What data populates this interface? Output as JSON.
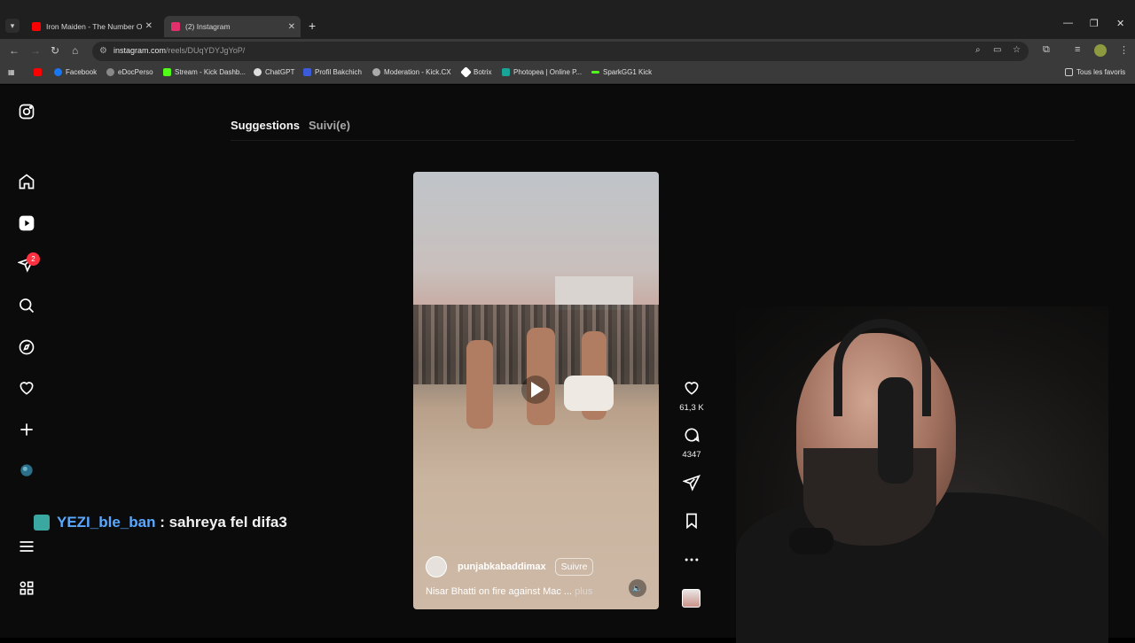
{
  "browser": {
    "tabs": [
      {
        "title": "Iron Maiden - The Number Of T",
        "favicon_color": "#ff0000",
        "active": false
      },
      {
        "title": "(2) Instagram",
        "favicon_color": "#e1306c",
        "active": true
      }
    ],
    "url_host": "instagram.com",
    "url_path": "/reels/DUqYDYJgYoP/",
    "bookmarks": [
      {
        "label": "",
        "color": "#ff0000"
      },
      {
        "label": "Facebook",
        "color": "#1877f2"
      },
      {
        "label": "eDocPerso",
        "color": "#cccccc"
      },
      {
        "label": "Stream - Kick Dashb...",
        "color": "#53fc18"
      },
      {
        "label": "ChatGPT",
        "color": "#dddddd"
      },
      {
        "label": "Profil Bakchich",
        "color": "#3b5bdb"
      },
      {
        "label": "Moderation - Kick.CX",
        "color": "#cccccc"
      },
      {
        "label": "Botrix",
        "color": "#ffffff"
      },
      {
        "label": "Photopea | Online P...",
        "color": "#18a497"
      },
      {
        "label": "SparkGG1 Kick",
        "color": "#53fc18"
      }
    ],
    "all_bookmarks": "Tous les favoris"
  },
  "sidebar": {
    "notification_count": "2"
  },
  "feed_tabs": {
    "suggestions": "Suggestions",
    "following": "Suivi(e)"
  },
  "reel": {
    "username": "punjabkabaddimax",
    "follow_label": "Suivre",
    "caption": "Nisar Bhatti on fire against Mac ...",
    "more_label": "plus",
    "likes": "61,3 K",
    "comments": "4347"
  },
  "chat_overlay": {
    "user": "YEZI_ble_ban",
    "separator": " : ",
    "message": "sahreya fel difa3"
  }
}
